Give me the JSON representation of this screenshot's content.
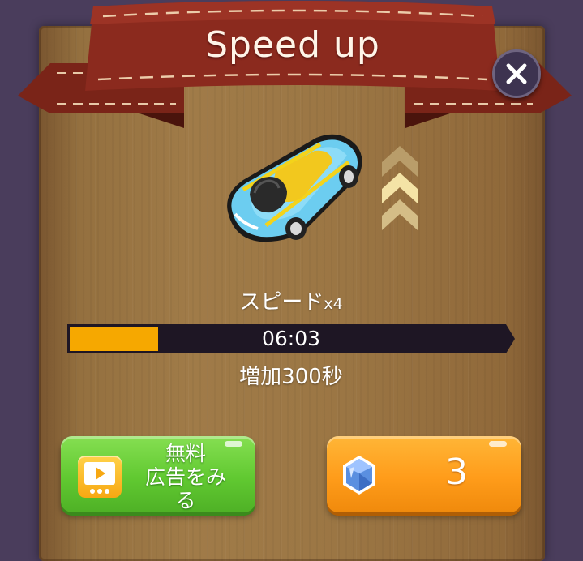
{
  "dialog": {
    "title": "Speed up",
    "close_icon": "close-icon"
  },
  "boost": {
    "speed_label": "スピード",
    "multiplier": "x4",
    "timer": "06:03",
    "progress_fraction": 0.2,
    "bonus_text": "増加300秒"
  },
  "buttons": {
    "ad_label": "無料\n広告をみる",
    "ad_icon": "video-ad-icon",
    "gem_icon": "diamond-gem-icon",
    "gem_cost": "3"
  },
  "colors": {
    "background": "#4a3d5c",
    "ribbon": "#8b2a1e",
    "progress_fill": "#f6a800",
    "ad_button": "#61c931",
    "gem_button": "#ff9c1a"
  }
}
